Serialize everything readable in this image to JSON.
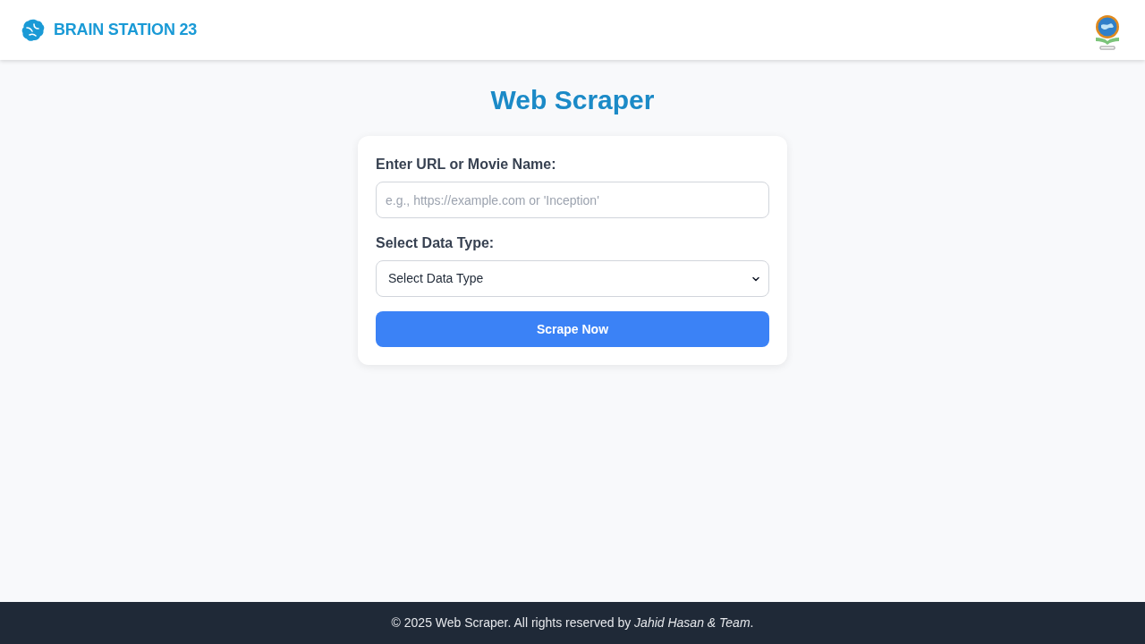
{
  "header": {
    "logo_text": "BRAIN STATION 23"
  },
  "title": "Web Scraper",
  "form": {
    "fields": [
      {
        "kind": "text",
        "label": "Enter URL or Movie Name:",
        "placeholder": "e.g., https://example.com or 'Inception'"
      },
      {
        "kind": "select",
        "label": "Select Data Type:",
        "value": "Select Data Type"
      }
    ],
    "submit": "Scrape Now"
  },
  "footer": {
    "text": "© 2025 Web Scraper. All rights reserved by *Jahid Hasan & Team*."
  }
}
